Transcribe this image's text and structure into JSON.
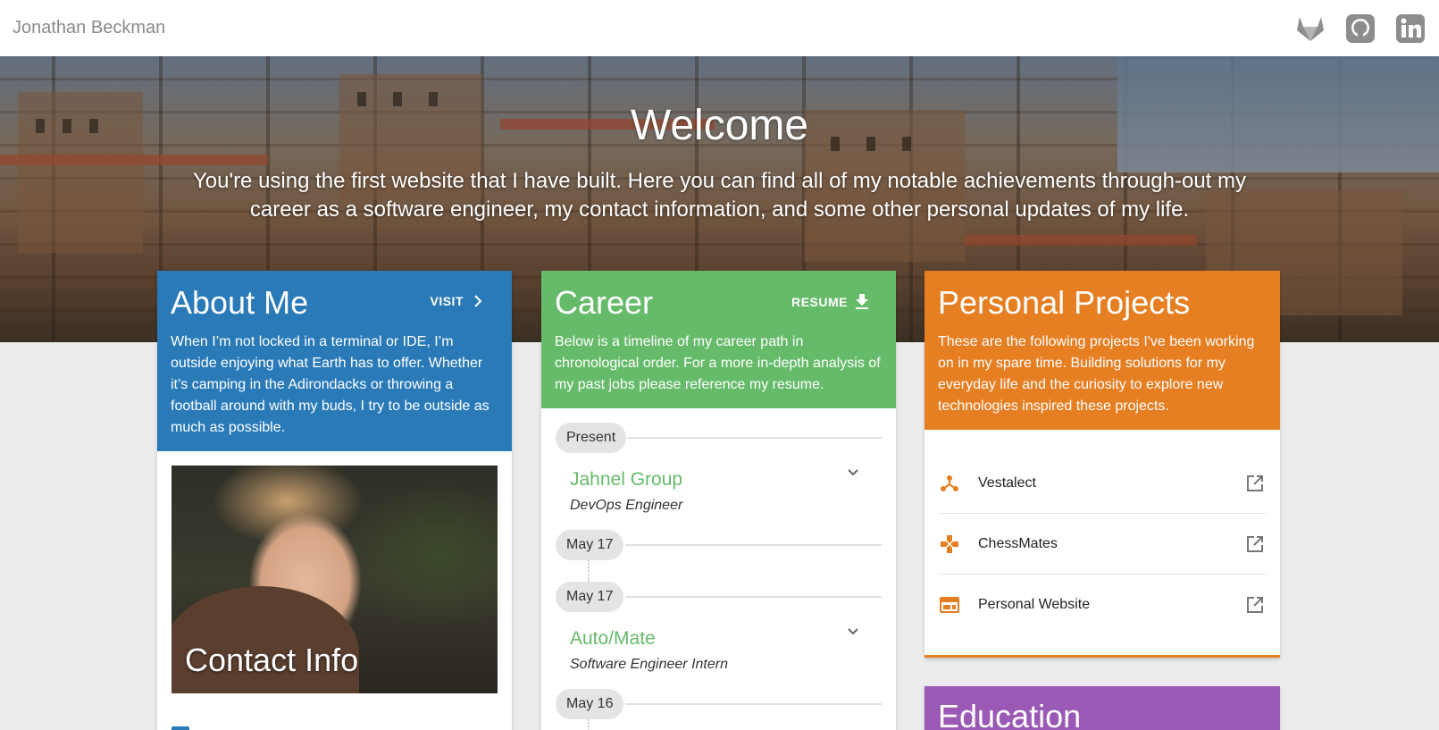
{
  "header": {
    "brand": "Jonathan Beckman",
    "socials": [
      {
        "name": "gitlab-icon"
      },
      {
        "name": "github-icon"
      },
      {
        "name": "linkedin-icon"
      }
    ]
  },
  "hero": {
    "title": "Welcome",
    "text": "You're using the first website that I have built. Here you can find all of my notable achievements through-out my career as a software engineer, my contact information, and some other personal updates of my life."
  },
  "about": {
    "title": "About Me",
    "action": "VISIT",
    "description": "When I’m not locked in a terminal or IDE, I’m outside enjoying what Earth has to offer. Whether it’s camping in the Adirondacks or throwing a football around with my buds, I try to be outside as much as possible.",
    "photo_caption": "Contact Info",
    "color": "#2a7ab8"
  },
  "career": {
    "title": "Career",
    "action": "RESUME",
    "description": "Below is a timeline of my career path in chronological order. For a more in-depth analysis of my past jobs please reference my resume.",
    "color": "#66bb6a",
    "timeline": [
      {
        "start": "Present",
        "company": "Jahnel Group",
        "role": "DevOps Engineer",
        "end": "May 17"
      },
      {
        "start": "May 17",
        "company": "Auto/Mate",
        "role": "Software Engineer Intern",
        "end": "May 16"
      }
    ]
  },
  "projects": {
    "title": "Personal Projects",
    "description": "These are the following projects I've been working on in my spare time. Building solutions for my everyday life and the curiosity to explore new technologies inspired these projects.",
    "color": "#e67e22",
    "items": [
      {
        "name": "Vestalect",
        "icon": "hub-icon"
      },
      {
        "name": "ChessMates",
        "icon": "gamepad-icon"
      },
      {
        "name": "Personal Website",
        "icon": "web-icon"
      }
    ]
  },
  "education": {
    "title": "Education",
    "color": "#9b59b6"
  }
}
